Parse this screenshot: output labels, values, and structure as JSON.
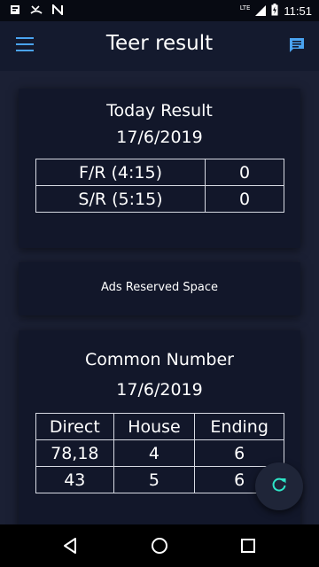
{
  "status_bar": {
    "time": "11:51",
    "network": "LTE",
    "icons": [
      "sim-card-icon",
      "missed-call-icon",
      "n-icon",
      "signal-icon",
      "battery-charging-icon"
    ]
  },
  "app_bar": {
    "title": "Teer result",
    "menu_icon": "menu-icon",
    "chat_icon": "chat-icon"
  },
  "today_result": {
    "title": "Today Result",
    "date": "17/6/2019",
    "rows": [
      {
        "label": "F/R (4:15)",
        "value": "0"
      },
      {
        "label": "S/R (5:15)",
        "value": "0"
      }
    ]
  },
  "ads": {
    "text": "Ads Reserved Space"
  },
  "common_number": {
    "title": "Common Number",
    "date": "17/6/2019",
    "headers": [
      "Direct",
      "House",
      "Ending"
    ],
    "rows": [
      [
        "78,18",
        "4",
        "6"
      ],
      [
        "43",
        "5",
        "6"
      ]
    ]
  },
  "fab": {
    "icon": "refresh-icon"
  },
  "nav_bar": {
    "back_icon": "back-icon",
    "home_icon": "home-icon",
    "recents_icon": "recents-icon"
  },
  "colors": {
    "background": "#1b2034",
    "card": "#12172a",
    "accent": "#4aa3f0",
    "fab_icon": "#2ee6c8"
  }
}
